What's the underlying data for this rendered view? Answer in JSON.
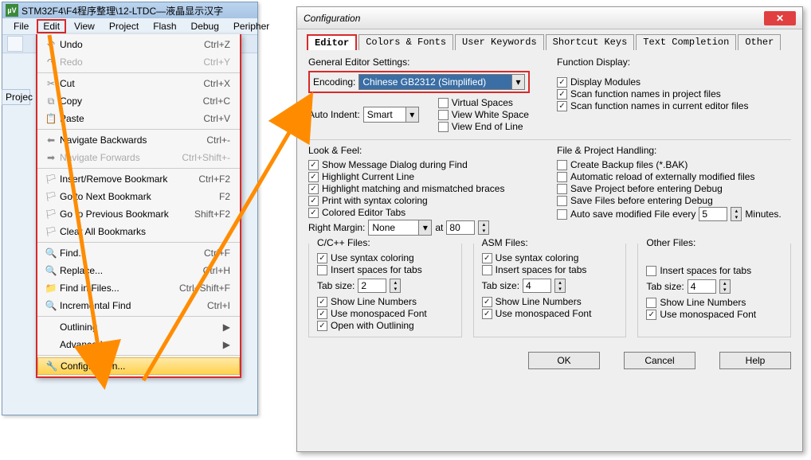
{
  "titlebar": "STM32F4\\F4程序整理\\12-LTDC—液晶显示汉字",
  "menubar": [
    "File",
    "Edit",
    "View",
    "Project",
    "Flash",
    "Debug",
    "Peripher"
  ],
  "project_tab": "Projec",
  "edit_menu": {
    "undo": {
      "label": "Undo",
      "sc": "Ctrl+Z"
    },
    "redo": {
      "label": "Redo",
      "sc": "Ctrl+Y"
    },
    "cut": {
      "label": "Cut",
      "sc": "Ctrl+X"
    },
    "copy": {
      "label": "Copy",
      "sc": "Ctrl+C"
    },
    "paste": {
      "label": "Paste",
      "sc": "Ctrl+V"
    },
    "navb": {
      "label": "Navigate Backwards",
      "sc": "Ctrl+-"
    },
    "navf": {
      "label": "Navigate Forwards",
      "sc": "Ctrl+Shift+-"
    },
    "insb": {
      "label": "Insert/Remove Bookmark",
      "sc": "Ctrl+F2"
    },
    "gonb": {
      "label": "Go to Next Bookmark",
      "sc": "F2"
    },
    "gopb": {
      "label": "Go to Previous Bookmark",
      "sc": "Shift+F2"
    },
    "clrb": {
      "label": "Clear All Bookmarks"
    },
    "find": {
      "label": "Find...",
      "sc": "Ctrl+F"
    },
    "replace": {
      "label": "Replace...",
      "sc": "Ctrl+H"
    },
    "findf": {
      "label": "Find in Files...",
      "sc": "Ctrl+Shift+F"
    },
    "incf": {
      "label": "Incremental Find",
      "sc": "Ctrl+I"
    },
    "outl": {
      "label": "Outlining"
    },
    "adv": {
      "label": "Advanced"
    },
    "conf": {
      "label": "Configuration..."
    }
  },
  "dlg_title": "Configuration",
  "tabs": [
    "Editor",
    "Colors & Fonts",
    "User Keywords",
    "Shortcut Keys",
    "Text Completion",
    "Other"
  ],
  "general": {
    "title": "General Editor Settings:",
    "encoding_lbl": "Encoding:",
    "encoding_val": "Chinese GB2312 (Simplified)",
    "auto_indent_lbl": "Auto Indent:",
    "auto_indent_val": "Smart",
    "virtual": "Virtual Spaces",
    "whitespace": "View White Space",
    "eol": "View End of Line"
  },
  "func": {
    "title": "Function Display:",
    "modules": "Display Modules",
    "proj": "Scan function names in project files",
    "cur": "Scan function names in current editor files"
  },
  "look": {
    "title": "Look & Feel:",
    "msg": "Show Message Dialog during Find",
    "hl": "Highlight Current Line",
    "brace": "Highlight matching and mismatched braces",
    "print": "Print with syntax coloring",
    "tabs": "Colored Editor Tabs",
    "margin_lbl": "Right Margin:",
    "margin_val": "None",
    "at": "at",
    "at_val": "80"
  },
  "fph": {
    "title": "File & Project Handling:",
    "bak": "Create Backup files (*.BAK)",
    "reload": "Automatic reload of externally modified files",
    "savep": "Save Project before entering Debug",
    "savef": "Save Files before entering Debug",
    "auto": "Auto save modified File every",
    "auto_val": "5",
    "auto_unit": "Minutes."
  },
  "cfiles": {
    "title": "C/C++ Files:",
    "syntax": "Use syntax coloring",
    "spaces": "Insert spaces for tabs",
    "tabsize_lbl": "Tab size:",
    "tabsize": "2",
    "ln": "Show Line Numbers",
    "mono": "Use monospaced Font",
    "outl": "Open with Outlining"
  },
  "asm": {
    "title": "ASM Files:",
    "syntax": "Use syntax coloring",
    "spaces": "Insert spaces for tabs",
    "tabsize_lbl": "Tab size:",
    "tabsize": "4",
    "ln": "Show Line Numbers",
    "mono": "Use monospaced Font"
  },
  "other": {
    "title": "Other Files:",
    "spaces": "Insert spaces for tabs",
    "tabsize_lbl": "Tab size:",
    "tabsize": "4",
    "ln": "Show Line Numbers",
    "mono": "Use monospaced Font"
  },
  "buttons": {
    "ok": "OK",
    "cancel": "Cancel",
    "help": "Help"
  }
}
